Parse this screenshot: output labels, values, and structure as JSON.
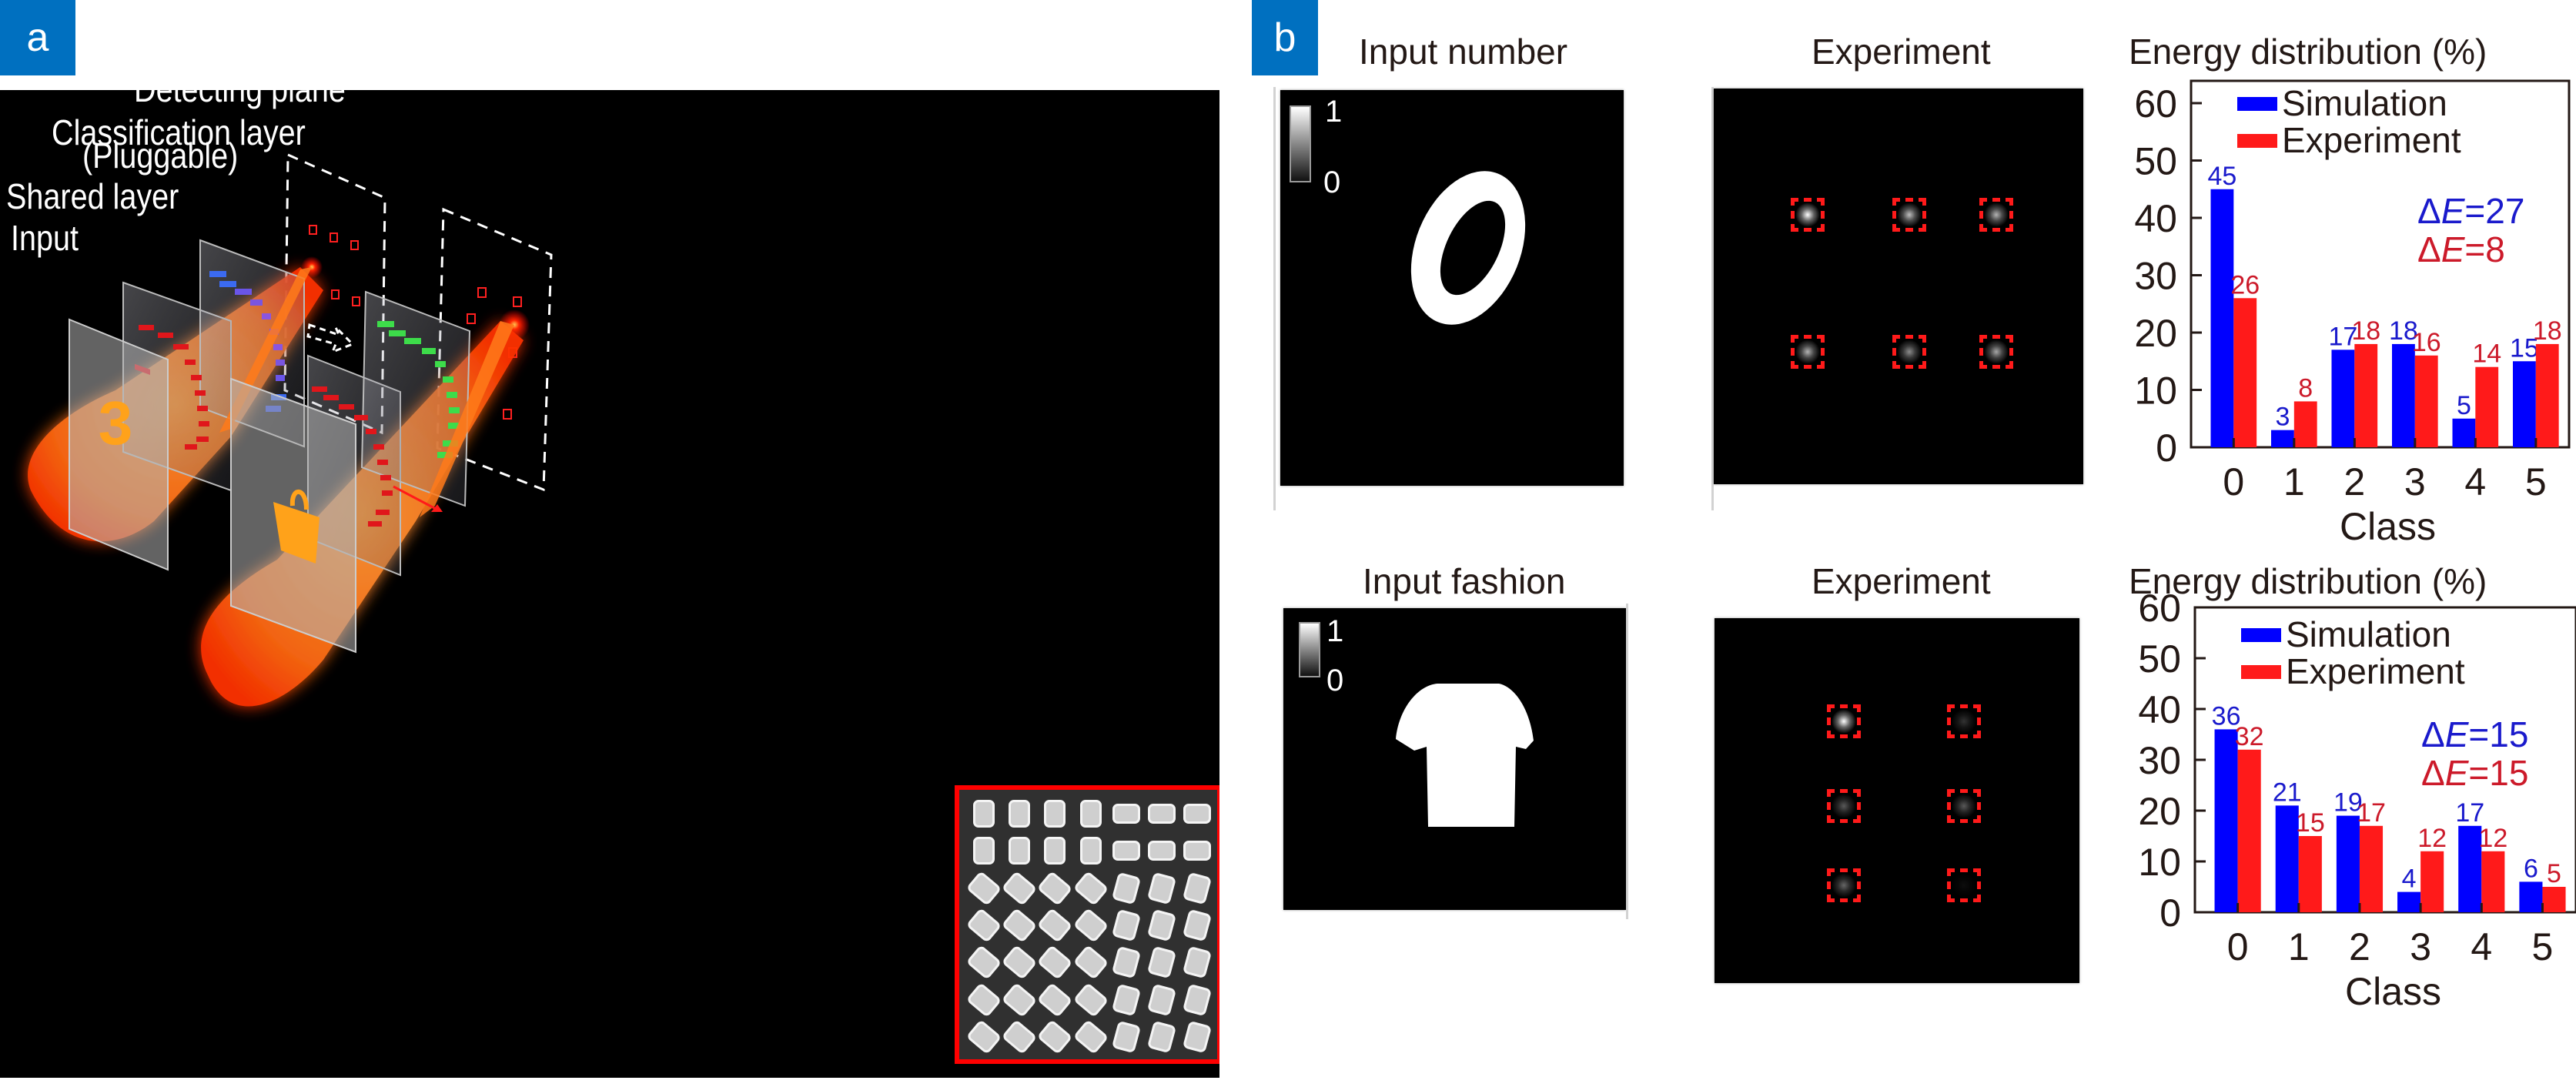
{
  "panel_labels": {
    "a": "a",
    "b": "b"
  },
  "panel_a": {
    "labels": {
      "detecting_plane": "Detecting plane",
      "classification_layer": "Classification layer",
      "classification_layer_note": "(Pluggable)",
      "shared_layer": "Shared layer",
      "input": "Input"
    },
    "input_symbols": [
      "3",
      "handbag"
    ],
    "metasurface_inset": {
      "rows": 7,
      "cols": 7,
      "description": "metasurface nanopillar array (SEM)"
    },
    "colors": {
      "beam": "#ff7a1a",
      "shared_layer_pillars": "#e0161b",
      "classification_layer_1": "#4a5cf0",
      "classification_layer_2": "#3ddc4a",
      "detector_square": "#ff2020",
      "inset_border": "#ff0000"
    }
  },
  "panel_b": {
    "rows": [
      {
        "input_title": "Input number",
        "experiment_title": "Experiment",
        "colorbar": {
          "max": "1",
          "min": "0"
        },
        "input_shape": "digit-0",
        "detector_layout": "2x3"
      },
      {
        "input_title": "Input fashion",
        "experiment_title": "Experiment",
        "colorbar": {
          "max": "1",
          "min": "0"
        },
        "input_shape": "t-shirt",
        "detector_layout": "3x2"
      }
    ]
  },
  "chart_data": [
    {
      "type": "bar",
      "title": "Energy distribution (%)",
      "xlabel": "Class",
      "ylabel": "",
      "categories": [
        "0",
        "1",
        "2",
        "3",
        "4",
        "5"
      ],
      "series": [
        {
          "name": "Simulation",
          "color": "#0000ff",
          "label_color": "#1a1acc",
          "values": [
            45,
            3,
            17,
            18,
            5,
            15
          ]
        },
        {
          "name": "Experiment",
          "color": "#ff1a1a",
          "label_color": "#cc1a2a",
          "values": [
            26,
            8,
            18,
            16,
            14,
            18
          ]
        }
      ],
      "ylim": [
        0,
        60
      ],
      "yticks": [
        "0",
        "10",
        "20",
        "30",
        "40",
        "50",
        "60"
      ],
      "legend": "top-left",
      "annotations": [
        {
          "text_prefix": "Δ",
          "text_italic": "E",
          "text_suffix": "=27",
          "color": "#1a1acc"
        },
        {
          "text_prefix": "Δ",
          "text_italic": "E",
          "text_suffix": "=8",
          "color": "#cc1a2a"
        }
      ],
      "grid": false
    },
    {
      "type": "bar",
      "title": "Energy distribution (%)",
      "xlabel": "Class",
      "ylabel": "",
      "categories": [
        "0",
        "1",
        "2",
        "3",
        "4",
        "5"
      ],
      "series": [
        {
          "name": "Simulation",
          "color": "#0000ff",
          "label_color": "#1a1acc",
          "values": [
            36,
            21,
            19,
            4,
            17,
            6
          ]
        },
        {
          "name": "Experiment",
          "color": "#ff1a1a",
          "label_color": "#cc1a2a",
          "values": [
            32,
            15,
            17,
            12,
            12,
            5
          ]
        }
      ],
      "ylim": [
        0,
        60
      ],
      "yticks": [
        "0",
        "10",
        "20",
        "30",
        "40",
        "50",
        "60"
      ],
      "legend": "top-left",
      "annotations": [
        {
          "text_prefix": "Δ",
          "text_italic": "E",
          "text_suffix": "=15",
          "color": "#1a1acc"
        },
        {
          "text_prefix": "Δ",
          "text_italic": "E",
          "text_suffix": "=15",
          "color": "#cc1a2a"
        }
      ],
      "grid": false
    }
  ]
}
